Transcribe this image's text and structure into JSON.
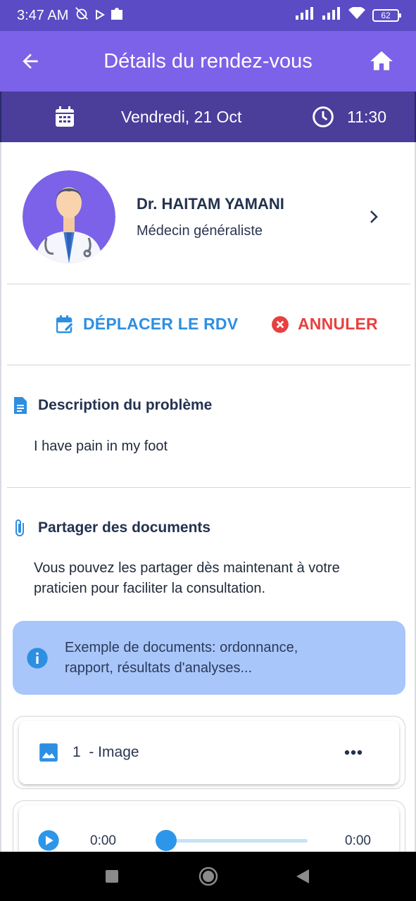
{
  "status_bar": {
    "time": "3:47 AM",
    "battery": "62"
  },
  "app_bar": {
    "title": "Détails du rendez-vous",
    "back_icon": "arrow-left-icon",
    "home_icon": "home-icon"
  },
  "appointment": {
    "date": "Vendredi, 21 Oct",
    "time": "11:30"
  },
  "doctor": {
    "name": "Dr. HAITAM YAMANI",
    "specialty": "Médecin généraliste"
  },
  "actions": {
    "move_label": "DÉPLACER LE RDV",
    "cancel_label": "ANNULER"
  },
  "description": {
    "title": "Description du problème",
    "text": "I have pain in my foot"
  },
  "documents": {
    "title": "Partager des documents",
    "intro": "Vous pouvez les partager dès maintenant à votre praticien pour faciliter la consultation.",
    "info_line1": "Exemple de documents: ordonnance,",
    "info_line2": "rapport, résultats d'analyses...",
    "files": [
      {
        "index": "1",
        "label": "- Image"
      }
    ]
  },
  "audio": {
    "current": "0:00",
    "total": "0:00",
    "progress": 0
  },
  "colors": {
    "status_bar": "#5b4bc4",
    "app_bar": "#7b62e8",
    "date_bar": "#4b3d9a",
    "accent_blue": "#2d8fe2",
    "danger_red": "#e84040",
    "info_bg": "#a9c6fb"
  }
}
